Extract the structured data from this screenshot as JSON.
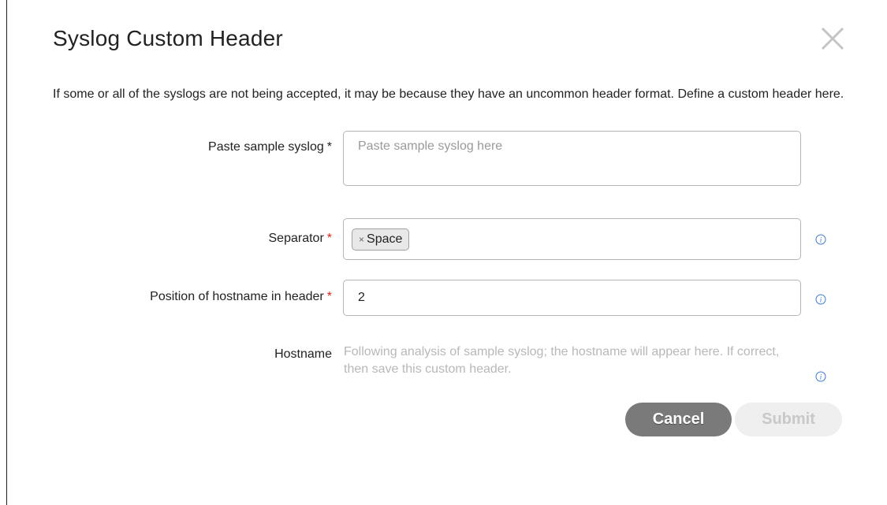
{
  "dialog": {
    "title": "Syslog Custom Header",
    "description": "If some or all of the syslogs are not being accepted, it may be because they have an uncommon header format. Define a custom header here."
  },
  "fields": {
    "sample": {
      "label": "Paste sample syslog",
      "required_mark": "*",
      "placeholder": "Paste sample syslog here",
      "value": ""
    },
    "separator": {
      "label": "Separator",
      "required_mark": "*",
      "tags": [
        {
          "label": "Space",
          "remove_glyph": "×"
        }
      ]
    },
    "position": {
      "label": "Position of hostname in header",
      "required_mark": "*",
      "value": "2"
    },
    "hostname": {
      "label": "Hostname",
      "hint": "Following analysis of sample syslog; the hostname will appear here. If correct, then save this custom header."
    }
  },
  "buttons": {
    "cancel": "Cancel",
    "submit": "Submit"
  },
  "icons": {
    "close": "close-icon",
    "info": "info-icon"
  },
  "colors": {
    "required_red": "#e2231a",
    "cancel_bg": "#7a7a7a",
    "submit_bg": "#efefef",
    "hint_text": "#b8b8b8"
  }
}
